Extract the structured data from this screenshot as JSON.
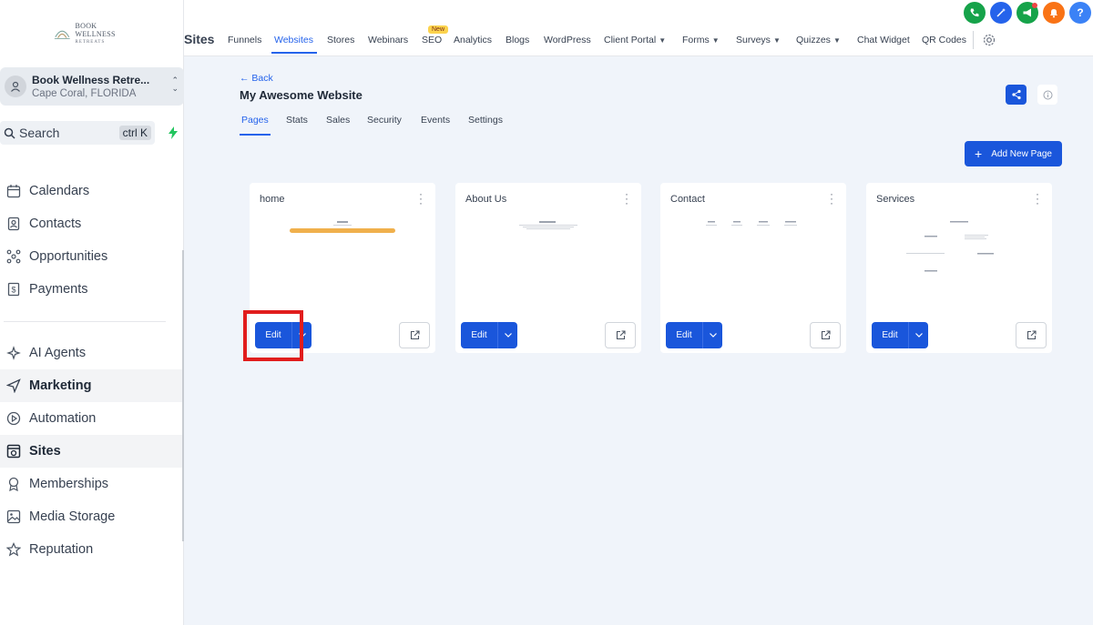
{
  "colors": {
    "accent": "#1a56db",
    "highlight": "#e11d1d",
    "new_badge": "#fcd34d"
  },
  "logo": {
    "line1": "BOOK WELLNESS",
    "line2": "RETREATS"
  },
  "account": {
    "name": "Book Wellness Retre...",
    "location": "Cape Coral, FLORIDA"
  },
  "search": {
    "label": "Search",
    "shortcut": "ctrl K"
  },
  "sidebar": {
    "items": [
      {
        "label": "Calendars",
        "icon": "calendar-icon"
      },
      {
        "label": "Contacts",
        "icon": "contacts-icon"
      },
      {
        "label": "Opportunities",
        "icon": "opportunities-icon"
      },
      {
        "label": "Payments",
        "icon": "payments-icon"
      },
      {
        "label": "AI Agents",
        "icon": "ai-agents-icon"
      },
      {
        "label": "Marketing",
        "icon": "send-icon"
      },
      {
        "label": "Automation",
        "icon": "automation-icon"
      },
      {
        "label": "Sites",
        "icon": "sites-icon"
      },
      {
        "label": "Memberships",
        "icon": "award-icon"
      },
      {
        "label": "Media Storage",
        "icon": "image-icon"
      },
      {
        "label": "Reputation",
        "icon": "star-icon"
      }
    ]
  },
  "topnav": {
    "title": "Sites",
    "new_badge": "New",
    "tabs": [
      {
        "label": "Funnels"
      },
      {
        "label": "Websites"
      },
      {
        "label": "Stores"
      },
      {
        "label": "Webinars"
      },
      {
        "label": "SEO"
      },
      {
        "label": "Analytics"
      },
      {
        "label": "Blogs"
      },
      {
        "label": "WordPress"
      },
      {
        "label": "Client Portal"
      },
      {
        "label": "Forms"
      },
      {
        "label": "Surveys"
      },
      {
        "label": "Quizzes"
      },
      {
        "label": "Chat Widget"
      },
      {
        "label": "QR Codes"
      }
    ],
    "help": "?"
  },
  "page": {
    "back": "← Back",
    "title": "My Awesome Website",
    "subtabs": [
      {
        "label": "Pages"
      },
      {
        "label": "Stats"
      },
      {
        "label": "Sales"
      },
      {
        "label": "Security"
      },
      {
        "label": "Events"
      },
      {
        "label": "Settings"
      }
    ],
    "add_page": "Add New Page"
  },
  "cards": [
    {
      "title": "home",
      "edit": "Edit"
    },
    {
      "title": "About Us",
      "edit": "Edit"
    },
    {
      "title": "Contact",
      "edit": "Edit"
    },
    {
      "title": "Services",
      "edit": "Edit"
    }
  ]
}
